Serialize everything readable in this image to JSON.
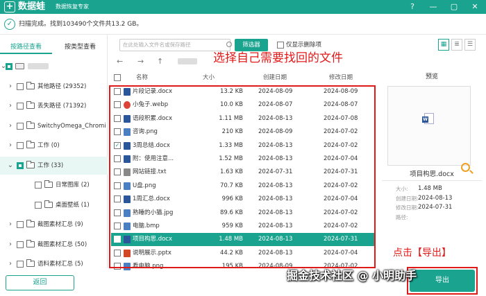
{
  "app": {
    "name": "数据蛙",
    "subtitle": "数据恢复专家"
  },
  "window_buttons": [
    "?",
    "—",
    "▢",
    "✕"
  ],
  "status": {
    "text": "扫描完成。找到103490个文件共13.2 GB。"
  },
  "sidebar": {
    "tabs": [
      {
        "label": "按路径查看",
        "active": true
      },
      {
        "label": "按类型查看",
        "active": false
      }
    ],
    "tree": [
      {
        "label": "",
        "level": 0,
        "expanded": true,
        "checkbox": "partial",
        "kind": "drive"
      },
      {
        "label": "其他路径 (29352)",
        "level": 1,
        "expanded": false,
        "checkbox": "empty",
        "kind": "folder"
      },
      {
        "label": "丢失路径 (71392)",
        "level": 1,
        "expanded": false,
        "checkbox": "empty",
        "kind": "folder"
      },
      {
        "label": "SwitchyOmega_Chromium",
        "level": 1,
        "expanded": false,
        "checkbox": "empty",
        "kind": "folder"
      },
      {
        "label": "工作 (0)",
        "level": 1,
        "expanded": false,
        "checkbox": "empty",
        "kind": "folder"
      },
      {
        "label": "工作 (33)",
        "level": 1,
        "expanded": true,
        "checkbox": "partial",
        "kind": "folder",
        "selected": true
      },
      {
        "label": "日常图库 (2)",
        "level": 2,
        "expanded": false,
        "checkbox": "empty",
        "kind": "folder"
      },
      {
        "label": "桌面壁纸 (1)",
        "level": 2,
        "expanded": false,
        "checkbox": "empty",
        "kind": "folder"
      },
      {
        "label": "截图素材汇总 (9)",
        "level": 1,
        "expanded": false,
        "checkbox": "empty",
        "kind": "folder"
      },
      {
        "label": "截图素材汇总 (50)",
        "level": 1,
        "expanded": false,
        "checkbox": "empty",
        "kind": "folder"
      },
      {
        "label": "语料素材汇总 (5)",
        "level": 1,
        "expanded": false,
        "checkbox": "empty",
        "kind": "folder"
      }
    ],
    "back_label": "返回"
  },
  "toolbar": {
    "search_placeholder": "在此处输入文件名或保存路径",
    "filter_label": "筛选器",
    "show_deleted_label": "仅显示删除项"
  },
  "annotation_top": "选择自己需要找回的文件",
  "table": {
    "headers": {
      "name": "名称",
      "size": "大小",
      "created": "创建日期",
      "modified": "修改日期"
    },
    "rows": [
      {
        "name": "片段记录.docx",
        "size": "13.2 KB",
        "created": "2024-08-09",
        "modified": "2024-08-09",
        "checked": false,
        "icon": "word-icon",
        "color": "#2b579a"
      },
      {
        "name": "小兔子.webp",
        "size": "10.0 KB",
        "created": "2024-08-07",
        "modified": "2024-08-07",
        "checked": false,
        "icon": "chrome-icon",
        "color": "#db4437"
      },
      {
        "name": "语段积累.docx",
        "size": "1.11 MB",
        "created": "2024-08-13",
        "modified": "2024-07-08",
        "checked": false,
        "icon": "word-icon",
        "color": "#2b579a"
      },
      {
        "name": "咨询.png",
        "size": "210 KB",
        "created": "2024-08-09",
        "modified": "2024-07-02",
        "checked": false,
        "icon": "image-icon",
        "color": "#4a7fc1"
      },
      {
        "name": "3周总结.docx",
        "size": "1.33 MB",
        "created": "2024-08-13",
        "modified": "2024-07-02",
        "checked": true,
        "icon": "word-icon",
        "color": "#2b579a"
      },
      {
        "name": "附：使用注意...",
        "size": "1.52 MB",
        "created": "2024-08-13",
        "modified": "2024-07-04",
        "checked": false,
        "icon": "word-icon",
        "color": "#2b579a"
      },
      {
        "name": "网站链接.txt",
        "size": "1.63 KB",
        "created": "2024-07-31",
        "modified": "2024-07-31",
        "checked": false,
        "icon": "text-icon",
        "color": "#888888"
      },
      {
        "name": "U盘.png",
        "size": "70.7 KB",
        "created": "2024-08-13",
        "modified": "2024-07-02",
        "checked": false,
        "icon": "image-icon",
        "color": "#4a7fc1"
      },
      {
        "name": "1周汇总.docx",
        "size": "996 KB",
        "created": "2024-08-13",
        "modified": "2024-07-04",
        "checked": false,
        "icon": "word-icon",
        "color": "#2b579a"
      },
      {
        "name": "熟睡的小猫.jpg",
        "size": "89.6 KB",
        "created": "2024-08-13",
        "modified": "2024-07-02",
        "checked": false,
        "icon": "image-icon",
        "color": "#4a7fc1"
      },
      {
        "name": "电脑.bmp",
        "size": "959 KB",
        "created": "2024-08-13",
        "modified": "2024-07-02",
        "checked": false,
        "icon": "image-icon",
        "color": "#4a7fc1"
      },
      {
        "name": "项目构思.docx",
        "size": "1.48 MB",
        "created": "2024-08-13",
        "modified": "2024-07-31",
        "checked": false,
        "icon": "word-icon",
        "color": "#2b579a",
        "selected": true
      },
      {
        "name": "说明展示.pptx",
        "size": "44.2 KB",
        "created": "2024-08-13",
        "modified": "2024-07-04",
        "checked": false,
        "icon": "ppt-icon",
        "color": "#d24726"
      },
      {
        "name": "看电脑.png",
        "size": "195 KB",
        "created": "2024-08-09",
        "modified": "2024-07-02",
        "checked": false,
        "icon": "image-icon",
        "color": "#4a7fc1"
      }
    ]
  },
  "preview": {
    "title": "预览",
    "file_name": "项目构思.docx",
    "meta": [
      {
        "key": "大小:",
        "value": "1.48 MB"
      },
      {
        "key": "创建日期:",
        "value": "2024-08-13"
      },
      {
        "key": "修改日期:",
        "value": "2024-07-31"
      },
      {
        "key": "路径:",
        "value": ""
      }
    ]
  },
  "annotation_bottom": "点击【导出】",
  "export_label": "导出",
  "watermark": "掘金技术社区 @ 小明助手",
  "colors": {
    "accent": "#1aa38f",
    "annotation": "#e01919"
  }
}
